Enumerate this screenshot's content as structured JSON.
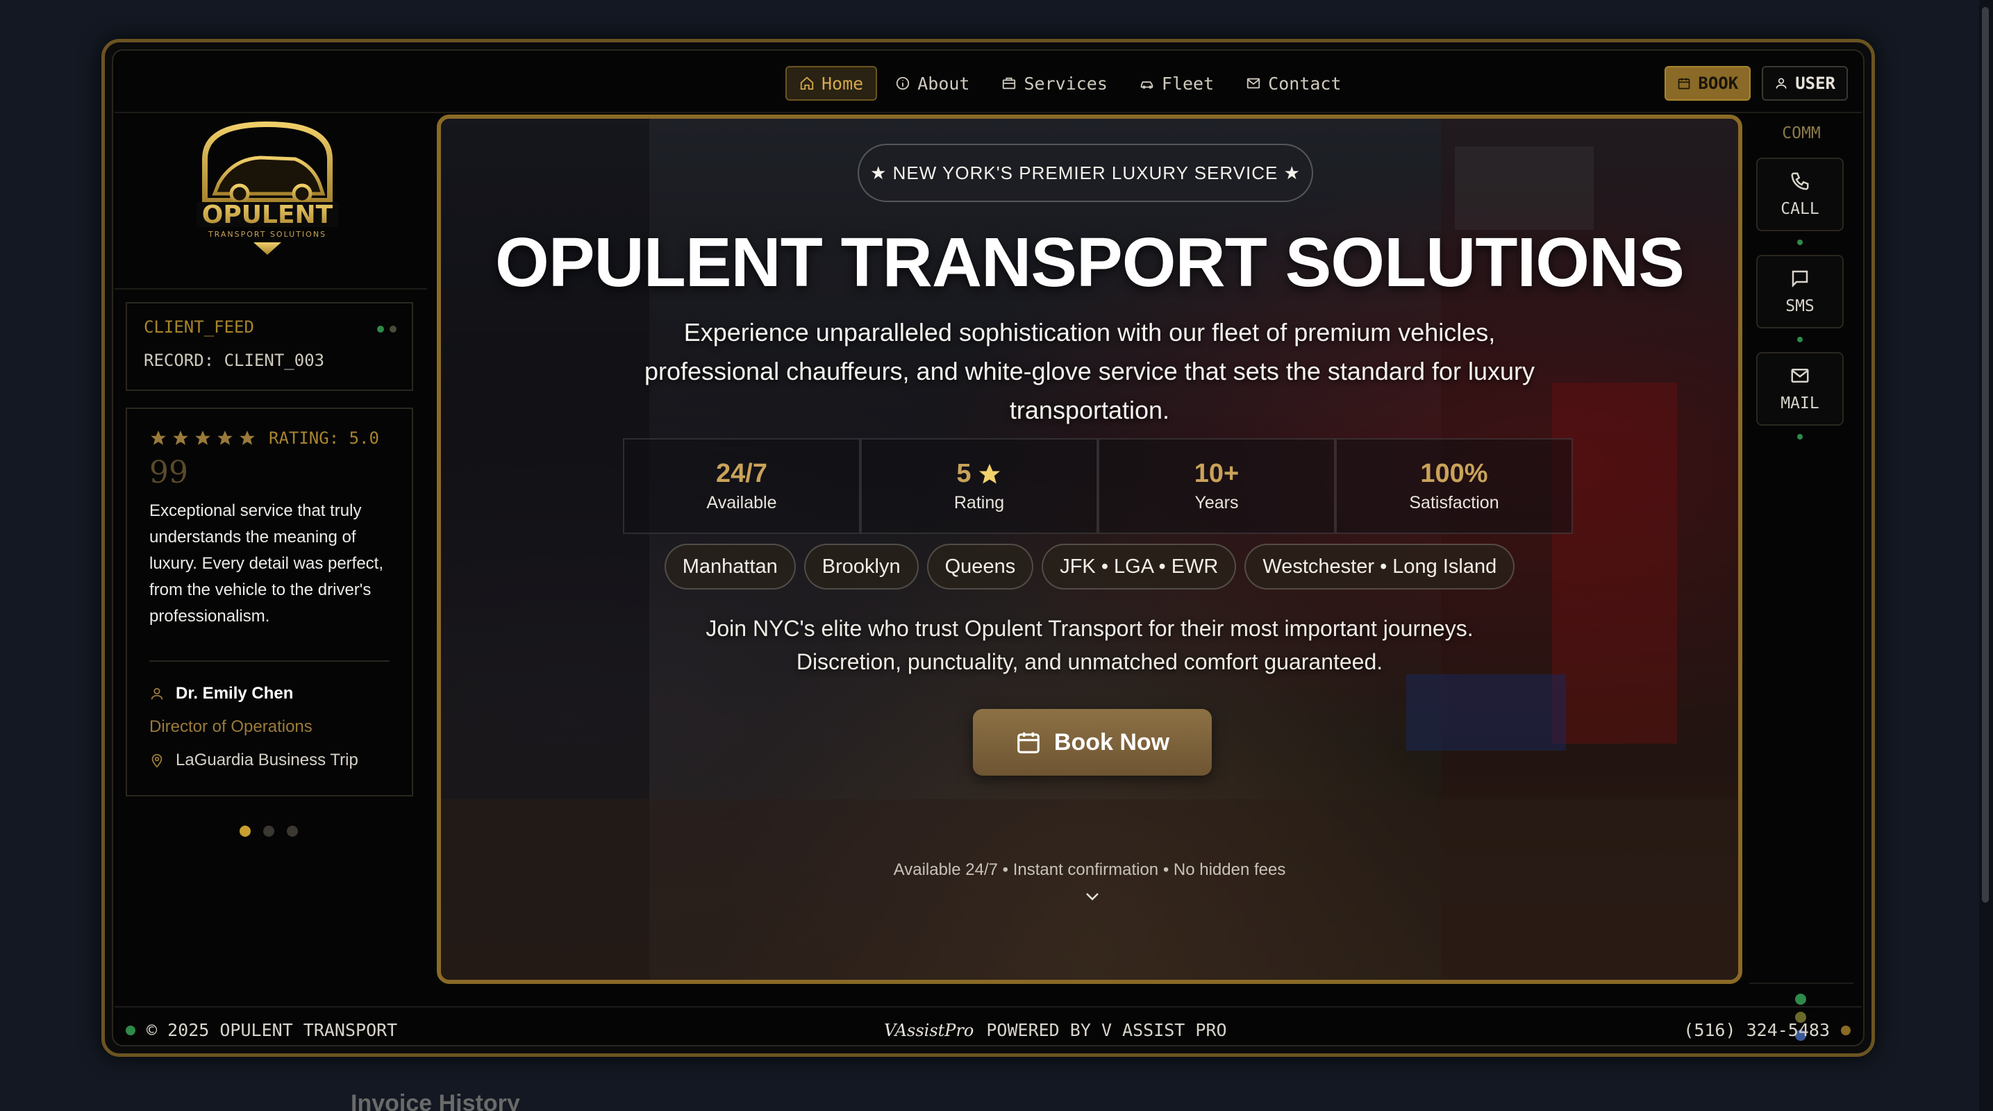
{
  "nav": {
    "items": [
      {
        "label": "Home",
        "icon": "home-icon",
        "active": true
      },
      {
        "label": "About",
        "icon": "info-icon",
        "active": false
      },
      {
        "label": "Services",
        "icon": "briefcase-icon",
        "active": false
      },
      {
        "label": "Fleet",
        "icon": "car-icon",
        "active": false
      },
      {
        "label": "Contact",
        "icon": "mail-icon",
        "active": false
      }
    ],
    "book_label": "BOOK",
    "user_label": "USER"
  },
  "logo": {
    "name": "OPULENT",
    "tagline": "TRANSPORT SOLUTIONS"
  },
  "feed": {
    "title": "CLIENT_FEED",
    "record": "RECORD: CLIENT_003"
  },
  "testimonial": {
    "stars": 5,
    "rating_text": "RATING: 5.0",
    "quote_mark": "99",
    "body": "Exceptional service that truly understands the meaning of luxury. Every detail was perfect, from the vehicle to the driver's professionalism.",
    "name": "Dr. Emily Chen",
    "role": "Director of Operations",
    "location": "LaGuardia Business Trip",
    "pager_total": 3,
    "pager_active": 0
  },
  "hero": {
    "badge": "★ NEW YORK'S PREMIER LUXURY SERVICE ★",
    "title": "OPULENT TRANSPORT SOLUTIONS",
    "subtitle": "Experience unparalleled sophistication with our fleet of premium vehicles, professional chauffeurs, and white-glove service that sets the standard for luxury transportation.",
    "stats": [
      {
        "value": "24/7",
        "label": "Available"
      },
      {
        "value": "5",
        "label": "Rating",
        "icon": "star-icon"
      },
      {
        "value": "10+",
        "label": "Years"
      },
      {
        "value": "100%",
        "label": "Satisfaction"
      }
    ],
    "areas": [
      "Manhattan",
      "Brooklyn",
      "Queens",
      "JFK • LGA • EWR",
      "Westchester • Long Island"
    ],
    "join_line1": "Join NYC's elite who trust Opulent Transport for their most important journeys.",
    "join_line2": "Discretion, punctuality, and unmatched comfort guaranteed.",
    "cta_label": "Book Now",
    "fine_print": "Available 24/7 • Instant confirmation • No hidden fees"
  },
  "comm": {
    "title": "COMM",
    "buttons": [
      {
        "label": "CALL",
        "icon": "phone-icon"
      },
      {
        "label": "SMS",
        "icon": "message-icon"
      },
      {
        "label": "MAIL",
        "icon": "mail-icon"
      }
    ]
  },
  "footer": {
    "copyright": "© 2025 OPULENT TRANSPORT",
    "powered_logo": "VAssistPro",
    "powered": "POWERED BY V ASSIST PRO",
    "phone": "(516) 324-5483"
  },
  "background_peek": "Invoice History",
  "colors": {
    "gold": "#a8842e",
    "gold_light": "#d4a84b",
    "status_green": "#2f8a4a",
    "status_blue": "#3a5a9a",
    "status_olive": "#6a6a2a"
  }
}
